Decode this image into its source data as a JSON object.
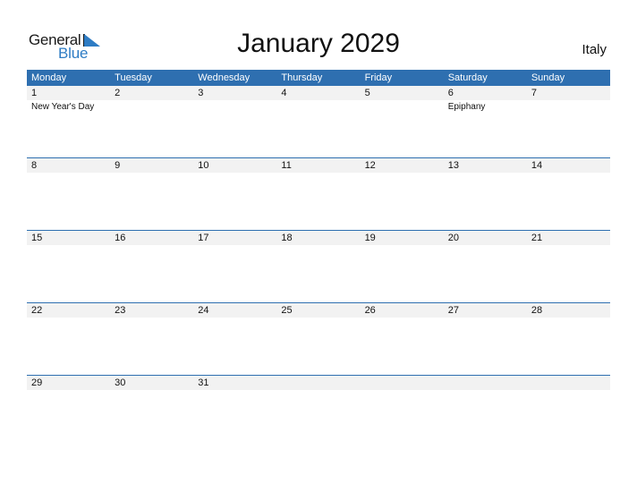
{
  "logo": {
    "word1": "General",
    "word2": "Blue"
  },
  "title": "January 2029",
  "country": "Italy",
  "colors": {
    "header_bg": "#2E6FB0",
    "date_strip": "#F2F2F2",
    "brand_blue": "#2E7CC4"
  },
  "weekdays": [
    "Monday",
    "Tuesday",
    "Wednesday",
    "Thursday",
    "Friday",
    "Saturday",
    "Sunday"
  ],
  "weeks": [
    {
      "days": [
        {
          "day": "1",
          "holiday": "New Year's Day"
        },
        {
          "day": "2",
          "holiday": ""
        },
        {
          "day": "3",
          "holiday": ""
        },
        {
          "day": "4",
          "holiday": ""
        },
        {
          "day": "5",
          "holiday": ""
        },
        {
          "day": "6",
          "holiday": "Epiphany"
        },
        {
          "day": "7",
          "holiday": ""
        }
      ]
    },
    {
      "days": [
        {
          "day": "8",
          "holiday": ""
        },
        {
          "day": "9",
          "holiday": ""
        },
        {
          "day": "10",
          "holiday": ""
        },
        {
          "day": "11",
          "holiday": ""
        },
        {
          "day": "12",
          "holiday": ""
        },
        {
          "day": "13",
          "holiday": ""
        },
        {
          "day": "14",
          "holiday": ""
        }
      ]
    },
    {
      "days": [
        {
          "day": "15",
          "holiday": ""
        },
        {
          "day": "16",
          "holiday": ""
        },
        {
          "day": "17",
          "holiday": ""
        },
        {
          "day": "18",
          "holiday": ""
        },
        {
          "day": "19",
          "holiday": ""
        },
        {
          "day": "20",
          "holiday": ""
        },
        {
          "day": "21",
          "holiday": ""
        }
      ]
    },
    {
      "days": [
        {
          "day": "22",
          "holiday": ""
        },
        {
          "day": "23",
          "holiday": ""
        },
        {
          "day": "24",
          "holiday": ""
        },
        {
          "day": "25",
          "holiday": ""
        },
        {
          "day": "26",
          "holiday": ""
        },
        {
          "day": "27",
          "holiday": ""
        },
        {
          "day": "28",
          "holiday": ""
        }
      ]
    },
    {
      "days": [
        {
          "day": "29",
          "holiday": ""
        },
        {
          "day": "30",
          "holiday": ""
        },
        {
          "day": "31",
          "holiday": ""
        },
        {
          "day": "",
          "holiday": ""
        },
        {
          "day": "",
          "holiday": ""
        },
        {
          "day": "",
          "holiday": ""
        },
        {
          "day": "",
          "holiday": ""
        }
      ]
    }
  ]
}
